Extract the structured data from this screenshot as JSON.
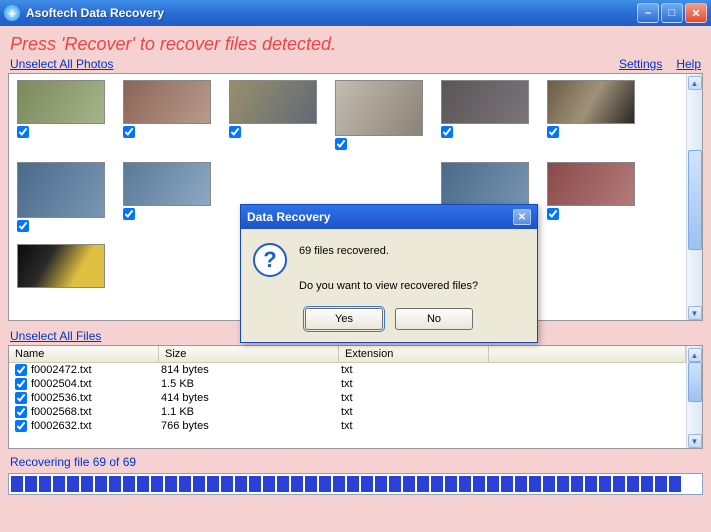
{
  "window": {
    "title": "Asoftech Data Recovery"
  },
  "subtitle": "Press 'Recover' to recover files detected.",
  "links": {
    "unselect_photos": "Unselect All Photos",
    "unselect_files": "Unselect All Files",
    "settings": "Settings",
    "help": "Help"
  },
  "file_table": {
    "headers": {
      "name": "Name",
      "size": "Size",
      "ext": "Extension"
    },
    "rows": [
      {
        "name": "f0002472.txt",
        "size": "814 bytes",
        "ext": "txt"
      },
      {
        "name": "f0002504.txt",
        "size": "1.5 KB",
        "ext": "txt"
      },
      {
        "name": "f0002536.txt",
        "size": "414 bytes",
        "ext": "txt"
      },
      {
        "name": "f0002568.txt",
        "size": "1.1 KB",
        "ext": "txt"
      },
      {
        "name": "f0002632.txt",
        "size": "766 bytes",
        "ext": "txt"
      }
    ]
  },
  "status": "Recovering file 69 of 69",
  "dialog": {
    "title": "Data Recovery",
    "line1": "69 files recovered.",
    "line2": "Do you want to view recovered files?",
    "yes": "Yes",
    "no": "No"
  }
}
